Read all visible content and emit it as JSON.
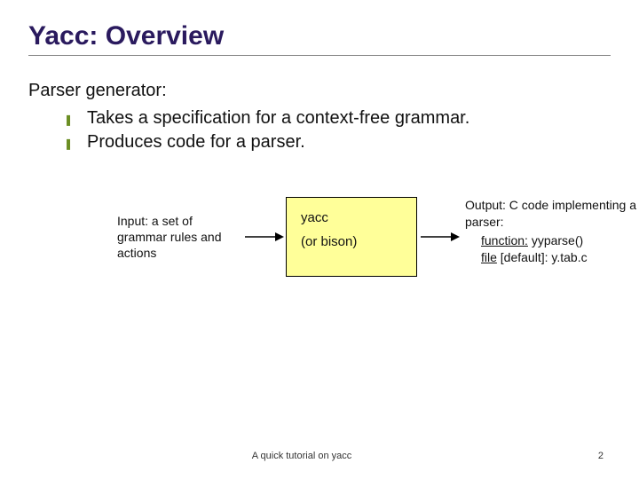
{
  "title": "Yacc: Overview",
  "lead": "Parser generator:",
  "bullets": [
    "Takes a specification for a context-free grammar.",
    "Produces code for a parser."
  ],
  "diagram": {
    "input": "Input: a set of grammar rules and actions",
    "box": {
      "line1": "yacc",
      "line2": "(or bison)"
    },
    "output": {
      "head": "Output: C code implementing a parser:",
      "func_key": "function:",
      "func_val": " yyparse()",
      "file_key": "file",
      "file_mid": " [default]: ",
      "file_val": "y.tab.c"
    }
  },
  "footer": {
    "text": "A quick tutorial on yacc",
    "page": "2"
  }
}
